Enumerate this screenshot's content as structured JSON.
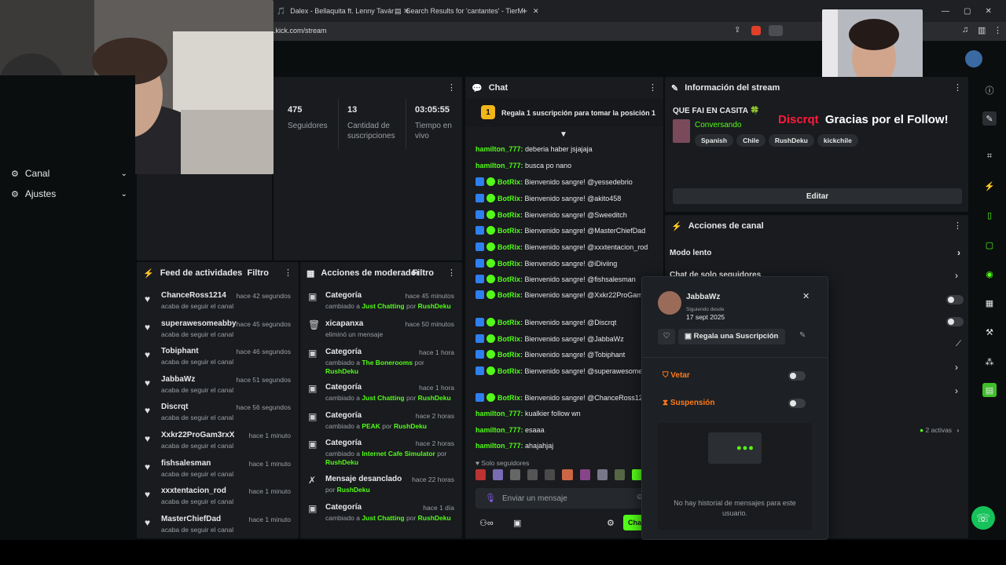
{
  "browser": {
    "tabs": [
      {
        "title": "Dalex - Bellaquita ft. Lenny Tavár",
        "icon": "music-icon"
      },
      {
        "title": "Search Results for 'cantantes' - TierM",
        "icon": "page-icon"
      }
    ],
    "new_tab": "+",
    "url": ".kick.com/stream"
  },
  "sidebar": {
    "items": [
      {
        "label": "Canal",
        "icon": "gear-icon"
      },
      {
        "label": "Ajustes",
        "icon": "gear-icon"
      }
    ]
  },
  "stats": [
    {
      "value": "475",
      "label": "Seguidores"
    },
    {
      "value": "13",
      "label": "Cantidad de suscripciones"
    },
    {
      "value": "03:05:55",
      "label": "Tiempo en vivo"
    }
  ],
  "feed": {
    "title": "Feed de actividades",
    "filter": "Filtro",
    "rows": [
      {
        "user": "ChanceRoss1214",
        "ago": "hace 42 segundos",
        "action": "acaba de seguir el canal"
      },
      {
        "user": "superawesomeabby",
        "ago": "hace 45 segundos",
        "action": "acaba de seguir el canal"
      },
      {
        "user": "Tobiphant",
        "ago": "hace 46 segundos",
        "action": "acaba de seguir el canal"
      },
      {
        "user": "JabbaWz",
        "ago": "hace 51 segundos",
        "action": "acaba de seguir el canal"
      },
      {
        "user": "Discrqt",
        "ago": "hace 56 segundos",
        "action": "acaba de seguir el canal"
      },
      {
        "user": "Xxkr22ProGam3rxX",
        "ago": "hace 1 minuto",
        "action": "acaba de seguir el canal"
      },
      {
        "user": "fishsalesman",
        "ago": "hace 1 minuto",
        "action": "acaba de seguir el canal"
      },
      {
        "user": "xxxtentacion_rod",
        "ago": "hace 1 minuto",
        "action": "acaba de seguir el canal"
      },
      {
        "user": "MasterChiefDad",
        "ago": "hace 1 minuto",
        "action": "acaba de seguir el canal"
      }
    ]
  },
  "mod": {
    "title": "Acciones de moderador",
    "filter": "Filtro",
    "rows": [
      {
        "title": "Categoría",
        "ago": "hace 45 minutos",
        "pre": "cambiado a ",
        "hl": "Just Chatting",
        "mid": " por ",
        "by": "RushDeku",
        "icon": "category-icon"
      },
      {
        "title": "xicapanxa",
        "ago": "hace 50 minutos",
        "pre": "eliminó un mensaje",
        "hl": "",
        "mid": "",
        "by": "",
        "icon": "trash-icon"
      },
      {
        "title": "Categoría",
        "ago": "hace 1 hora",
        "pre": "cambiado a ",
        "hl": "The Bonerooms",
        "mid": " por ",
        "by": "RushDeku",
        "icon": "category-icon"
      },
      {
        "title": "Categoría",
        "ago": "hace 1 hora",
        "pre": "cambiado a ",
        "hl": "Just Chatting",
        "mid": " por ",
        "by": "RushDeku",
        "icon": "category-icon"
      },
      {
        "title": "Categoría",
        "ago": "hace 2 horas",
        "pre": "cambiado a ",
        "hl": "PEAK",
        "mid": " por ",
        "by": "RushDeku",
        "icon": "category-icon"
      },
      {
        "title": "Categoría",
        "ago": "hace 2 horas",
        "pre": "cambiado a ",
        "hl": "Internet Cafe Simulator",
        "mid": " por ",
        "by": "RushDeku",
        "icon": "category-icon"
      },
      {
        "title": "Mensaje desanclado",
        "ago": "hace 22 horas",
        "pre": "por ",
        "hl": "",
        "mid": "",
        "by": "RushDeku",
        "icon": "unpin-icon"
      },
      {
        "title": "Categoría",
        "ago": "hace 1 día",
        "pre": "cambiado a ",
        "hl": "Just Chatting",
        "mid": " por ",
        "by": "RushDeku",
        "icon": "category-icon"
      }
    ]
  },
  "chat": {
    "title": "Chat",
    "pinned_badge": "1",
    "pinned": "Regala 1 suscripción para tomar la posición 1",
    "messages": [
      {
        "user": "hamilton_777",
        "badges": false,
        "text": "deberia haber jsjajaja"
      },
      {
        "user": "hamilton_777",
        "badges": false,
        "text": "busca po nano"
      },
      {
        "user": "BotRix",
        "badges": true,
        "text": "Bienvenido sangre! @yessedebrio"
      },
      {
        "user": "BotRix",
        "badges": true,
        "text": "Bienvenido sangre! @akito458"
      },
      {
        "user": "BotRix",
        "badges": true,
        "text": "Bienvenido sangre! @Sweeditch"
      },
      {
        "user": "BotRix",
        "badges": true,
        "text": "Bienvenido sangre! @MasterChiefDad"
      },
      {
        "user": "BotRix",
        "badges": true,
        "text": "Bienvenido sangre! @xxxtentacion_rod"
      },
      {
        "user": "BotRix",
        "badges": true,
        "text": "Bienvenido sangre! @iDiviing"
      },
      {
        "user": "BotRix",
        "badges": true,
        "text": "Bienvenido sangre! @fishsalesman"
      },
      {
        "user": "BotRix",
        "badges": true,
        "text": "Bienvenido sangre! @Xxkr22ProGam3rxX"
      },
      {
        "user": "BotRix",
        "badges": true,
        "text": "Bienvenido sangre! @Discrqt"
      },
      {
        "user": "BotRix",
        "badges": true,
        "text": "Bienvenido sangre! @JabbaWz"
      },
      {
        "user": "BotRix",
        "badges": true,
        "text": "Bienvenido sangre! @Tobiphant"
      },
      {
        "user": "BotRix",
        "badges": true,
        "text": "Bienvenido sangre! @superawesomeabby"
      },
      {
        "user": "BotRix",
        "badges": true,
        "text": "Bienvenido sangre! @ChanceRoss12"
      },
      {
        "user": "hamilton_777",
        "badges": false,
        "text": "kualkier follow wn"
      },
      {
        "user": "hamilton_777",
        "badges": false,
        "text": "esaaa"
      },
      {
        "user": "hamilton_777",
        "badges": false,
        "text": "ahajahjaj"
      }
    ],
    "followers_only": "Solo seguidores",
    "input_placeholder": "Enviar un mensaje",
    "send_label": "Cha"
  },
  "stream_info": {
    "title": "Información del stream",
    "stream_title": "QUE FAI EN CASITA 🍀",
    "category": "Conversando",
    "tags": [
      "Spanish",
      "Chile",
      "RushDeku",
      "kickchile"
    ],
    "edit": "Editar"
  },
  "alert": {
    "name": "Discrqt",
    "message": "Gracias por el Follow!"
  },
  "channel_actions": {
    "title": "Acciones de canal",
    "rows": [
      "Modo lento",
      "Chat de solo seguidores"
    ],
    "active_count": "2 activas"
  },
  "user_card": {
    "username": "JabbaWz",
    "following_label": "Siguiendo desde",
    "following_date": "17 sept 2025",
    "gift_label": "Regala una Suscripción",
    "veto_label": "Vetar",
    "timeout_label": "Suspensión",
    "empty_history": "No hay historial de mensajes para este usuario."
  },
  "colors": {
    "accent": "#53fc18",
    "panel": "#191b1f",
    "background": "#0b0e0f",
    "alert_name": "#ff1a3c",
    "mod_orange": "#ff7a1a"
  }
}
